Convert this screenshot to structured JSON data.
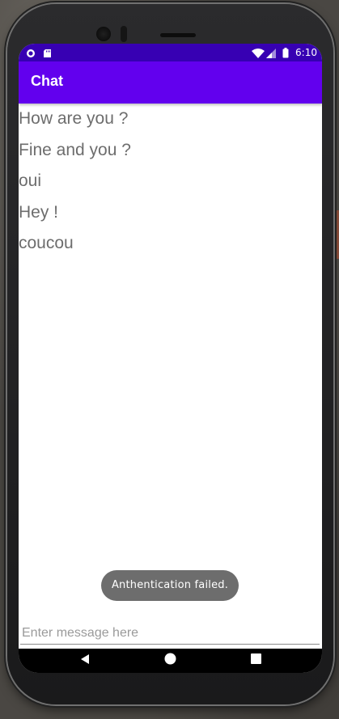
{
  "status_bar": {
    "time": "6:10",
    "icons": [
      "notification-circle-icon",
      "sd-card-icon",
      "wifi-icon",
      "signal-icon",
      "battery-icon"
    ]
  },
  "app_bar": {
    "title": "Chat"
  },
  "messages": [
    "How are you ?",
    "Fine and you ?",
    "oui",
    "Hey !",
    "coucou"
  ],
  "toast": {
    "text": "Anthentication failed."
  },
  "message_input": {
    "placeholder": "Enter message here",
    "value": ""
  },
  "nav_bar": {
    "buttons": [
      "back-icon",
      "home-icon",
      "recents-icon"
    ]
  },
  "colors": {
    "status_bar": "#3700b3",
    "app_bar": "#6200ee",
    "message_text": "#6d6d6d",
    "toast_bg": "#6d6d6d"
  }
}
